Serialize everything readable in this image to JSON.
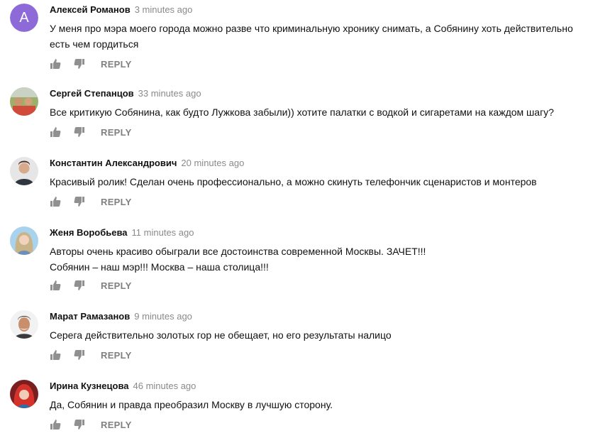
{
  "comments": [
    {
      "author": "Алексей Романов",
      "time": "3 minutes ago",
      "avatar_letter": "А",
      "lines": [
        "У меня про мэра моего города можно разве что криминальную хронику снимать, а Собянину хоть действительно есть чем гордиться"
      ],
      "reply_label": "REPLY"
    },
    {
      "author": "Сергей Степанцов",
      "time": "33 minutes ago",
      "lines": [
        "Все критикую Собянина, как будто Лужкова забыли)) хотите палатки с водкой и сигаретами на каждом шагу?"
      ],
      "reply_label": "REPLY"
    },
    {
      "author": "Константин Александрович",
      "time": "20 minutes ago",
      "lines": [
        "Красивый ролик! Сделан очень профессионально, а можно скинуть телефончик сценаристов и монтеров"
      ],
      "reply_label": "REPLY"
    },
    {
      "author": "Женя Воробьева",
      "time": "11 minutes ago",
      "lines": [
        "Авторы очень красиво обыграли все достоинства современной Москвы. ЗАЧЕТ!!!",
        "Собянин – наш мэр!!! Москва – наша столица!!!"
      ],
      "reply_label": "REPLY"
    },
    {
      "author": "Марат Рамазанов",
      "time": "9 minutes ago",
      "lines": [
        "Серега действительно золотых гор не обещает, но его результаты налицо"
      ],
      "reply_label": "REPLY"
    },
    {
      "author": "Ирина Кузнецова",
      "time": "46 minutes ago",
      "lines": [
        "Да, Собянин и правда преобразил Москву в лучшую сторону."
      ],
      "reply_label": "REPLY"
    }
  ],
  "colors": {
    "author": "#111111",
    "time": "#8a8a8a",
    "reply": "#808080",
    "icon": "#909090",
    "letter_avatar": "#8e6ad8"
  },
  "icons": {
    "like": "thumb-up-icon",
    "dislike": "thumb-down-icon"
  }
}
